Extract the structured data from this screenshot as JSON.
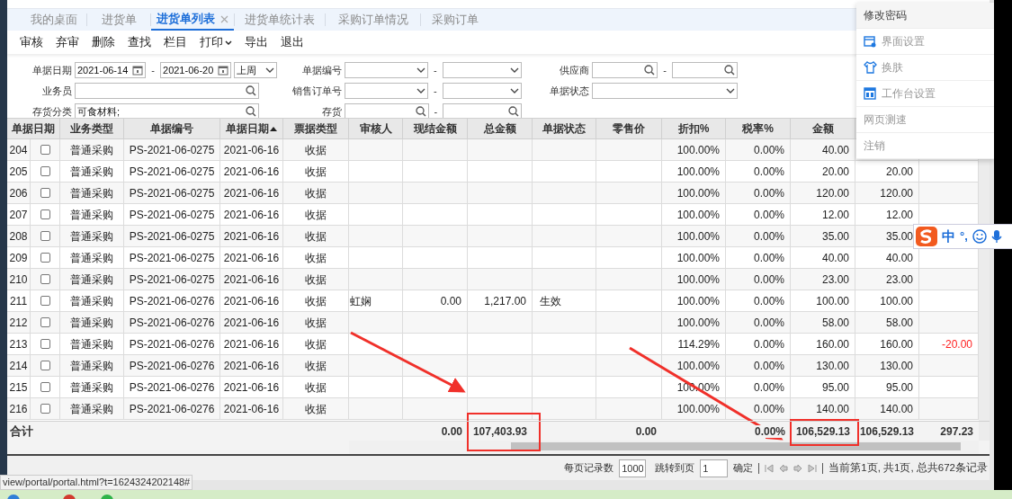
{
  "tabs": [
    {
      "label": "我的桌面",
      "selected": false
    },
    {
      "label": "进货单",
      "selected": false
    },
    {
      "label": "进货单列表",
      "selected": true
    },
    {
      "label": "进货单统计表",
      "selected": false
    },
    {
      "label": "采购订单情况",
      "selected": false
    },
    {
      "label": "采购订单",
      "selected": false
    }
  ],
  "toolbar": [
    {
      "label": "审核"
    },
    {
      "label": "弃审"
    },
    {
      "label": "删除"
    },
    {
      "label": "查找"
    },
    {
      "label": "栏目"
    },
    {
      "label": "打印",
      "dropdown": true
    },
    {
      "label": "导出"
    },
    {
      "label": "退出"
    }
  ],
  "filters": [
    {
      "label": "单据日期",
      "kind": "date_range",
      "from": "2021-06-14",
      "separator": "-",
      "to": "2021-06-20",
      "preset": "上周"
    },
    {
      "label": "单据编号",
      "kind": "select_range",
      "separator": "-"
    },
    {
      "label": "供应商",
      "kind": "search_range",
      "separator": "-"
    },
    {
      "label": "业务员",
      "kind": "search"
    },
    {
      "label": "销售订单号",
      "kind": "select_range",
      "separator": "-"
    },
    {
      "label": "单据状态",
      "kind": "select"
    },
    {
      "label": "存货分类",
      "kind": "search",
      "value": "可食材料;"
    },
    {
      "label": "存货",
      "kind": "search_range",
      "separator": "-"
    }
  ],
  "table": {
    "frozen_header": "单据日期",
    "columns": [
      {
        "label": "业务类型"
      },
      {
        "label": "单据编号"
      },
      {
        "label": "单据日期",
        "sorted_ascending": true
      },
      {
        "label": "票据类型"
      },
      {
        "label": "审核人"
      },
      {
        "label": "现结金额"
      },
      {
        "label": "总金额"
      },
      {
        "label": "单据状态"
      },
      {
        "label": "零售价"
      },
      {
        "label": "折扣%"
      },
      {
        "label": "税率%"
      },
      {
        "label": "金额"
      }
    ],
    "rows": [
      {
        "no": "204",
        "checked": false,
        "cells": [
          "普通采购",
          "PS-2021-06-0275",
          "2021-06-16",
          "收据",
          null,
          null,
          null,
          null,
          null,
          "100.00%",
          "0.00%",
          "40.00",
          null,
          null
        ]
      },
      {
        "no": "205",
        "checked": false,
        "cells": [
          "普通采购",
          "PS-2021-06-0275",
          "2021-06-16",
          "收据",
          null,
          null,
          null,
          null,
          null,
          "100.00%",
          "0.00%",
          "20.00",
          "20.00",
          null
        ]
      },
      {
        "no": "206",
        "checked": false,
        "cells": [
          "普通采购",
          "PS-2021-06-0275",
          "2021-06-16",
          "收据",
          null,
          null,
          null,
          null,
          null,
          "100.00%",
          "0.00%",
          "120.00",
          "120.00",
          null
        ]
      },
      {
        "no": "207",
        "checked": false,
        "cells": [
          "普通采购",
          "PS-2021-06-0275",
          "2021-06-16",
          "收据",
          null,
          null,
          null,
          null,
          null,
          "100.00%",
          "0.00%",
          "12.00",
          "12.00",
          null
        ]
      },
      {
        "no": "208",
        "checked": false,
        "cells": [
          "普通采购",
          "PS-2021-06-0275",
          "2021-06-16",
          "收据",
          null,
          null,
          null,
          null,
          null,
          "100.00%",
          "0.00%",
          "35.00",
          "35.00",
          null
        ]
      },
      {
        "no": "209",
        "checked": false,
        "cells": [
          "普通采购",
          "PS-2021-06-0275",
          "2021-06-16",
          "收据",
          null,
          null,
          null,
          null,
          null,
          "100.00%",
          "0.00%",
          "40.00",
          "40.00",
          null
        ]
      },
      {
        "no": "210",
        "checked": false,
        "cells": [
          "普通采购",
          "PS-2021-06-0275",
          "2021-06-16",
          "收据",
          null,
          null,
          null,
          null,
          null,
          "100.00%",
          "0.00%",
          "23.00",
          "23.00",
          null
        ]
      },
      {
        "no": "211",
        "checked": false,
        "cells": [
          "普通采购",
          "PS-2021-06-0276",
          "2021-06-16",
          "收据",
          "虹娴",
          "0.00",
          "1,217.00",
          "生效",
          null,
          "100.00%",
          "0.00%",
          "100.00",
          "100.00",
          null
        ]
      },
      {
        "no": "212",
        "checked": false,
        "cells": [
          "普通采购",
          "PS-2021-06-0276",
          "2021-06-16",
          "收据",
          null,
          null,
          null,
          null,
          null,
          "100.00%",
          "0.00%",
          "58.00",
          "58.00",
          null
        ]
      },
      {
        "no": "213",
        "checked": false,
        "cells": [
          "普通采购",
          "PS-2021-06-0276",
          "2021-06-16",
          "收据",
          null,
          null,
          null,
          null,
          null,
          "114.29%",
          "0.00%",
          "160.00",
          "160.00",
          "-20.00"
        ]
      },
      {
        "no": "214",
        "checked": false,
        "cells": [
          "普通采购",
          "PS-2021-06-0276",
          "2021-06-16",
          "收据",
          null,
          null,
          null,
          null,
          null,
          "100.00%",
          "0.00%",
          "130.00",
          "130.00",
          null
        ]
      },
      {
        "no": "215",
        "checked": false,
        "cells": [
          "普通采购",
          "PS-2021-06-0276",
          "2021-06-16",
          "收据",
          null,
          null,
          null,
          null,
          null,
          "100.00%",
          "0.00%",
          "95.00",
          "95.00",
          null
        ]
      },
      {
        "no": "216",
        "checked": false,
        "cells": [
          "普通采购",
          "PS-2021-06-0276",
          "2021-06-16",
          "收据",
          null,
          null,
          null,
          null,
          null,
          "100.00%",
          "0.00%",
          "140.00",
          "140.00",
          null
        ]
      }
    ],
    "totals": {
      "label": "合计",
      "cells": [
        null,
        null,
        null,
        null,
        null,
        "0.00",
        "107,403.93",
        null,
        "0.00",
        null,
        "0.00%",
        "106,529.13",
        "106,529.13",
        "297.23"
      ]
    }
  },
  "pager": {
    "page_size_label": "每页记录数",
    "page_size": "1000",
    "goto_label": "跳转到页",
    "goto_page": "1",
    "confirm": "确定",
    "summary": "当前第1页, 共1页, 总共672条记录"
  },
  "status_url": "view/portal/portal.html?t=1624324202148#",
  "user_menu": [
    {
      "label": "修改密码",
      "highlighted": true
    },
    {
      "label": "界面设置",
      "kind": "window-gear",
      "highlighted": false
    },
    {
      "label": "换肤",
      "kind": "shirt",
      "highlighted": false
    },
    {
      "label": "工作台设置",
      "kind": "layout",
      "highlighted": false
    },
    {
      "label": "网页测速",
      "highlighted": false
    },
    {
      "label": "注销",
      "highlighted": false
    }
  ],
  "ime_toolbar": {
    "mode": "中",
    "punctuation": "°,"
  }
}
